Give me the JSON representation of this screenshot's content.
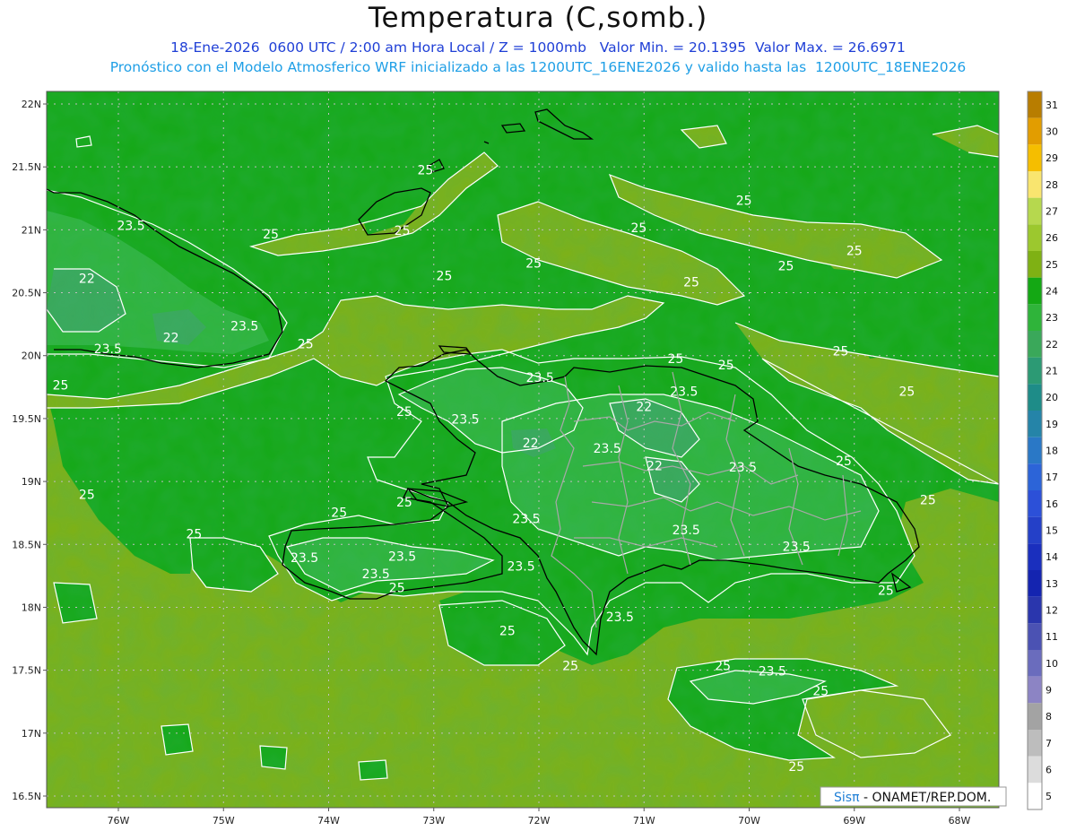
{
  "header": {
    "title": "Temperatura (C,somb.)",
    "subtitle_1": "18-Ene-2026  0600 UTC / 2:00 am Hora Local / Z = 1000mb   Valor Min. = 20.1395  Valor Max. = 26.6971",
    "subtitle_2": "Pronóstico con el Modelo Atmosferico WRF inicializado a las 1200UTC_16ENE2026 y valido hasta las  1200UTC_18ENE2026"
  },
  "map": {
    "lat_labels": [
      "22N",
      "21.5N",
      "21N",
      "20.5N",
      "20N",
      "19.5N",
      "19N",
      "18.5N",
      "18N",
      "17.5N",
      "17N",
      "16.5N"
    ],
    "lon_labels": [
      "76W",
      "75W",
      "74W",
      "73W",
      "72W",
      "71W",
      "70W",
      "69W",
      "68W"
    ],
    "lat_values": [
      22,
      21.5,
      21,
      20.5,
      20,
      19.5,
      19,
      18.5,
      18,
      17.5,
      17,
      16.5
    ],
    "lon_values": [
      -76,
      -75,
      -74,
      -73,
      -72,
      -71,
      -70,
      -69,
      -68
    ],
    "contour_labels": [
      {
        "text": "23.5",
        "lon": -75.88,
        "lat": 21.0
      },
      {
        "text": "22",
        "lon": -76.3,
        "lat": 20.58
      },
      {
        "text": "22",
        "lon": -75.5,
        "lat": 20.11
      },
      {
        "text": "23.5",
        "lon": -74.8,
        "lat": 20.2
      },
      {
        "text": "23.5",
        "lon": -76.1,
        "lat": 20.02
      },
      {
        "text": "25",
        "lon": -74.22,
        "lat": 20.06
      },
      {
        "text": "25",
        "lon": -76.55,
        "lat": 19.73
      },
      {
        "text": "25",
        "lon": -73.08,
        "lat": 21.44
      },
      {
        "text": "25",
        "lon": -74.55,
        "lat": 20.93
      },
      {
        "text": "25",
        "lon": -73.3,
        "lat": 20.96
      },
      {
        "text": "25",
        "lon": -72.9,
        "lat": 20.6
      },
      {
        "text": "25",
        "lon": -72.05,
        "lat": 20.7
      },
      {
        "text": "25",
        "lon": -71.05,
        "lat": 20.98
      },
      {
        "text": "25",
        "lon": -70.55,
        "lat": 20.55
      },
      {
        "text": "25",
        "lon": -70.05,
        "lat": 21.2
      },
      {
        "text": "25",
        "lon": -69.65,
        "lat": 20.68
      },
      {
        "text": "25",
        "lon": -69.0,
        "lat": 20.8
      },
      {
        "text": "25",
        "lon": -70.7,
        "lat": 19.94
      },
      {
        "text": "25",
        "lon": -70.22,
        "lat": 19.89
      },
      {
        "text": "25",
        "lon": -69.13,
        "lat": 20.0
      },
      {
        "text": "25",
        "lon": -68.5,
        "lat": 19.68
      },
      {
        "text": "23.5",
        "lon": -71.99,
        "lat": 19.79
      },
      {
        "text": "23.5",
        "lon": -70.62,
        "lat": 19.68
      },
      {
        "text": "22",
        "lon": -71.0,
        "lat": 19.56
      },
      {
        "text": "25",
        "lon": -73.28,
        "lat": 19.52
      },
      {
        "text": "23.5",
        "lon": -72.7,
        "lat": 19.46
      },
      {
        "text": "22",
        "lon": -72.08,
        "lat": 19.27
      },
      {
        "text": "23.5",
        "lon": -71.35,
        "lat": 19.23
      },
      {
        "text": "22",
        "lon": -70.9,
        "lat": 19.09
      },
      {
        "text": "23.5",
        "lon": -70.06,
        "lat": 19.08
      },
      {
        "text": "25",
        "lon": -69.1,
        "lat": 19.13
      },
      {
        "text": "25",
        "lon": -76.3,
        "lat": 18.86
      },
      {
        "text": "25",
        "lon": -73.28,
        "lat": 18.8
      },
      {
        "text": "25",
        "lon": -73.9,
        "lat": 18.72
      },
      {
        "text": "23.5",
        "lon": -72.12,
        "lat": 18.67
      },
      {
        "text": "23.5",
        "lon": -70.6,
        "lat": 18.58
      },
      {
        "text": "25",
        "lon": -68.3,
        "lat": 18.82
      },
      {
        "text": "25",
        "lon": -75.28,
        "lat": 18.55
      },
      {
        "text": "23.5",
        "lon": -74.23,
        "lat": 18.36
      },
      {
        "text": "23.5",
        "lon": -73.3,
        "lat": 18.37
      },
      {
        "text": "23.5",
        "lon": -73.55,
        "lat": 18.23
      },
      {
        "text": "23.5",
        "lon": -72.17,
        "lat": 18.29
      },
      {
        "text": "23.5",
        "lon": -69.55,
        "lat": 18.45
      },
      {
        "text": "25",
        "lon": -73.35,
        "lat": 18.12
      },
      {
        "text": "25",
        "lon": -68.7,
        "lat": 18.1
      },
      {
        "text": "23.5",
        "lon": -71.23,
        "lat": 17.89
      },
      {
        "text": "25",
        "lon": -72.3,
        "lat": 17.78
      },
      {
        "text": "25",
        "lon": -71.7,
        "lat": 17.5
      },
      {
        "text": "25",
        "lon": -70.25,
        "lat": 17.5
      },
      {
        "text": "23.5",
        "lon": -69.78,
        "lat": 17.46
      },
      {
        "text": "25",
        "lon": -69.32,
        "lat": 17.3
      },
      {
        "text": "25",
        "lon": -69.55,
        "lat": 16.7
      }
    ]
  },
  "colorbar": {
    "labels": [
      "31",
      "30",
      "29",
      "28",
      "27",
      "26",
      "25",
      "24",
      "23",
      "22",
      "21",
      "20",
      "19",
      "18",
      "17",
      "16",
      "15",
      "14",
      "13",
      "12",
      "11",
      "10",
      "9",
      "8",
      "7",
      "6",
      "5"
    ],
    "colors": [
      "#b87d00",
      "#e29d00",
      "#f5be00",
      "#f9e56f",
      "#b6d84e",
      "#9cc82e",
      "#7fb114",
      "#14a814",
      "#2fb43a",
      "#3aa85a",
      "#2c9a74",
      "#1e8c88",
      "#2584a8",
      "#2a78c6",
      "#2c64d8",
      "#2c50d8",
      "#2440c8",
      "#1a2fbe",
      "#1424b0",
      "#2a36ad",
      "#4b52b3",
      "#6a6cbd",
      "#8c84c4",
      "#a3a3a3",
      "#bdbdbd",
      "#dcdcdc",
      "#ffffff"
    ]
  },
  "credit": {
    "sis": "Sisπ",
    "text": " - ONAMET/REP.DOM."
  }
}
